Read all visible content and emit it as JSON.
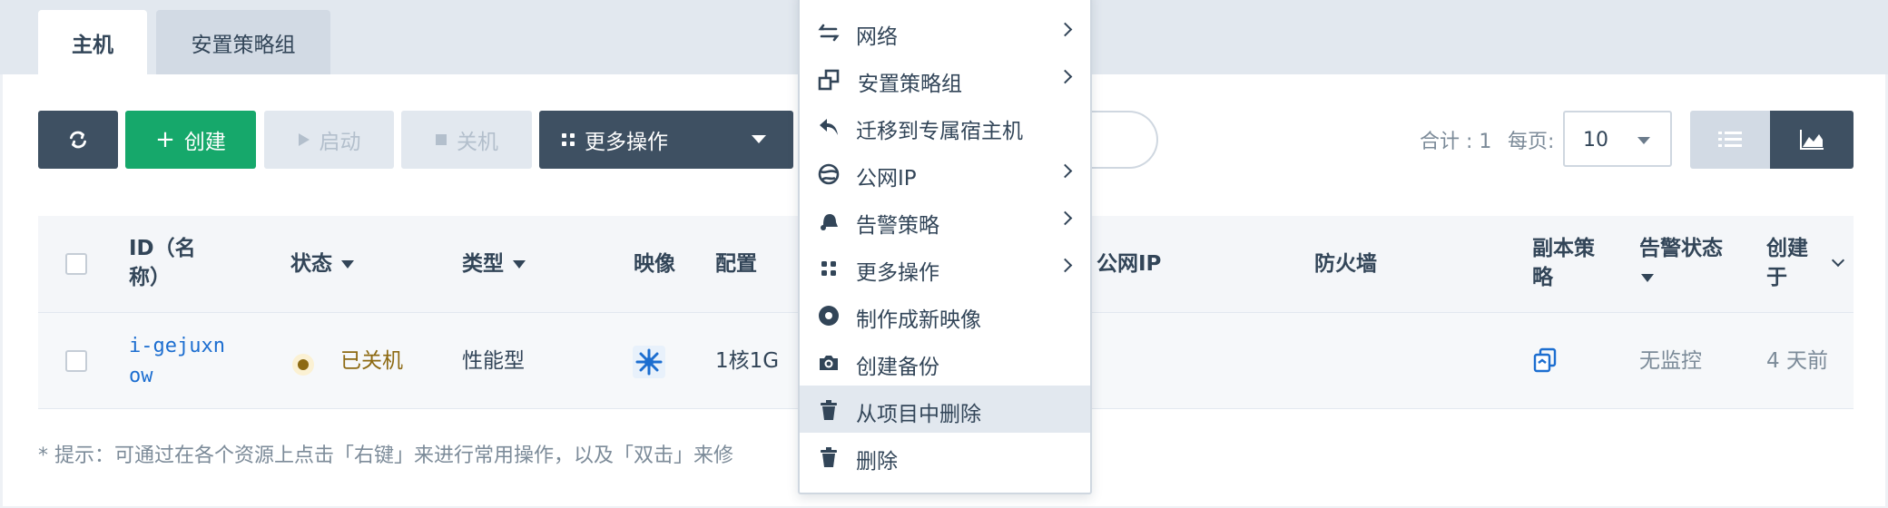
{
  "tabs": [
    {
      "label": "主机",
      "active": true
    },
    {
      "label": "安置策略组",
      "active": false
    }
  ],
  "toolbar": {
    "create_label": "创建",
    "start_label": "启动",
    "stop_label": "关机",
    "more_label": "更多操作"
  },
  "pagination": {
    "total_label": "合计 : 1",
    "per_page_label": "每页:",
    "per_page_value": "10"
  },
  "table": {
    "headers": {
      "id": "ID（名称）",
      "status": "状态",
      "type": "类型",
      "image": "映像",
      "config": "配置",
      "public_ip": "公网IP",
      "firewall": "防火墙",
      "replica": "副本策略",
      "alert": "告警状态",
      "created": "创建于"
    },
    "rows": [
      {
        "id_line1": "i-gejuxn",
        "id_line2": "ow",
        "status": "已关机",
        "type": "性能型",
        "config": "1核1G",
        "alert": "无监控",
        "created": "4 天前"
      }
    ]
  },
  "hint": "* 提示：可通过在各个资源上点击「右键」来进行常用操作，以及「双击」来修",
  "context_menu": {
    "items": [
      {
        "label": "网络",
        "icon": "swap-arrows-icon",
        "submenu": true
      },
      {
        "label": "安置策略组",
        "icon": "placement-group-icon",
        "submenu": true
      },
      {
        "label": "迁移到专属宿主机",
        "icon": "reply-arrow-icon",
        "submenu": false
      },
      {
        "label": "公网IP",
        "icon": "globe-icon",
        "submenu": true
      },
      {
        "label": "告警策略",
        "icon": "bell-icon",
        "submenu": true
      },
      {
        "label": "更多操作",
        "icon": "grid-dots-icon",
        "submenu": true
      },
      {
        "label": "制作成新映像",
        "icon": "disc-icon",
        "submenu": false
      },
      {
        "label": "创建备份",
        "icon": "camera-icon",
        "submenu": false
      },
      {
        "label": "从项目中删除",
        "icon": "trash-icon",
        "submenu": false,
        "highlighted": true
      },
      {
        "label": "删除",
        "icon": "trash-icon",
        "submenu": false
      }
    ]
  },
  "colors": {
    "accent_green": "#16a86b",
    "dark_button": "#3e5062",
    "link_blue": "#1c6ed0",
    "status_stopped": "#8d6a13"
  }
}
